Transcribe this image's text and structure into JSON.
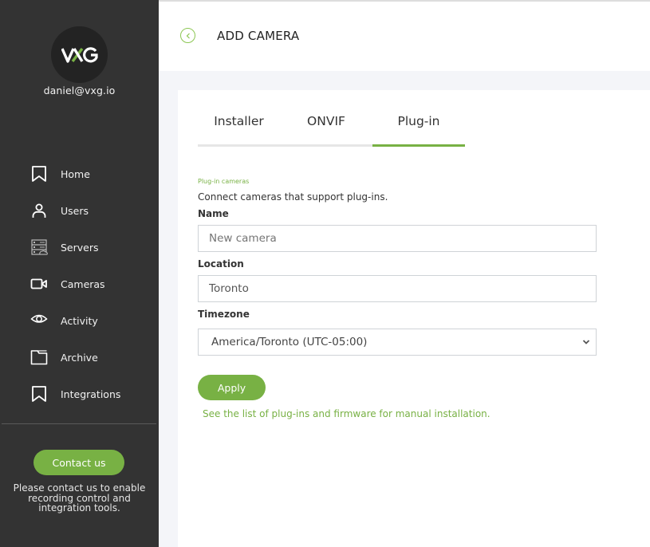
{
  "sidebar": {
    "logo": {
      "text_left": "V",
      "text_mid": "X",
      "text_right": "G",
      "accent": "#78b144"
    },
    "user_email": "daniel@vxg.io",
    "items": [
      {
        "label": "Home",
        "icon": "bookmark-icon"
      },
      {
        "label": "Users",
        "icon": "user-icon"
      },
      {
        "label": "Servers",
        "icon": "server-icon"
      },
      {
        "label": "Cameras",
        "icon": "video-camera-icon"
      },
      {
        "label": "Activity",
        "icon": "eye-icon"
      },
      {
        "label": "Archive",
        "icon": "folder-icon"
      },
      {
        "label": "Integrations",
        "icon": "bookmark-icon"
      }
    ],
    "contact_button": "Contact us",
    "contact_note": "Please contact us to enable recording control and integration tools."
  },
  "header": {
    "title": "ADD CAMERA",
    "back_icon": "chevron-left-icon"
  },
  "tabs": [
    {
      "label": "Installer",
      "active": false
    },
    {
      "label": "ONVIF",
      "active": false
    },
    {
      "label": "Plug-in",
      "active": true
    }
  ],
  "form": {
    "section_label": "Plug-in cameras",
    "section_desc": "Connect cameras that support plug-ins.",
    "name": {
      "label": "Name",
      "placeholder": "New camera",
      "value": ""
    },
    "location": {
      "label": "Location",
      "placeholder": "",
      "value": "Toronto"
    },
    "timezone": {
      "label": "Timezone",
      "selected": "America/Toronto (UTC-05:00)"
    },
    "apply_button": "Apply",
    "plugins_link": "See the list of plug-ins and firmware for manual installation."
  },
  "colors": {
    "accent": "#78b144",
    "sidebar_bg": "#333333",
    "page_bg": "#f4f5f9"
  }
}
